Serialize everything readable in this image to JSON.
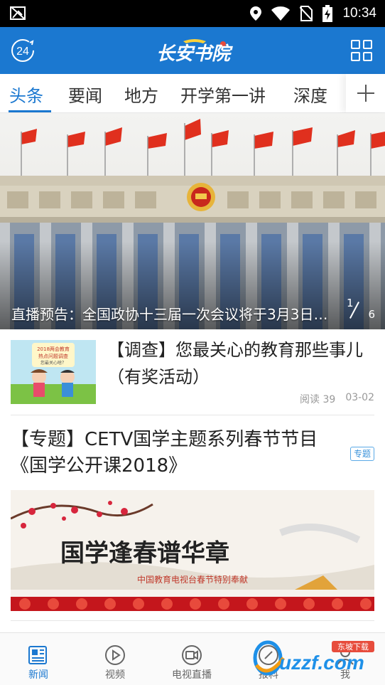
{
  "status_bar": {
    "time": "10:34"
  },
  "header": {
    "logo_text": "长安书院",
    "badge_number": "24"
  },
  "tabs": [
    {
      "label": "头条",
      "active": true
    },
    {
      "label": "要闻",
      "active": false
    },
    {
      "label": "地方",
      "active": false
    },
    {
      "label": "开学第一讲",
      "active": false
    },
    {
      "label": "深度",
      "active": false
    }
  ],
  "banner": {
    "caption": "直播预告：全国政协十三届一次会议将于3月3日…",
    "page_current": "1",
    "page_total": "6"
  },
  "article1": {
    "title": "【调查】您最关心的教育那些事儿（有奖活动）",
    "reads": "阅读 39",
    "date": "03-02",
    "thumb_text": [
      "2018两会教育",
      "热点问题调查",
      "您最关心啥？"
    ]
  },
  "article2": {
    "title": "【专题】CETV国学主题系列春节节目《国学公开课2018》",
    "tag": "专题",
    "image_title": "国学逢春谱华章",
    "image_sub": "中国教育电视台春节特别奉献"
  },
  "bottom_nav": [
    {
      "label": "新闻",
      "icon": "news-icon",
      "active": true
    },
    {
      "label": "视频",
      "icon": "video-play-icon",
      "active": false
    },
    {
      "label": "电视直播",
      "icon": "tv-camera-icon",
      "active": false
    },
    {
      "label": "报料",
      "icon": "report-icon",
      "active": false
    },
    {
      "label": "我",
      "icon": "profile-icon",
      "active": false
    }
  ],
  "watermark": {
    "text": "uzzf.com",
    "small": "东坡下载"
  },
  "colors": {
    "primary": "#1b78d0",
    "status_bar": "#000000"
  }
}
